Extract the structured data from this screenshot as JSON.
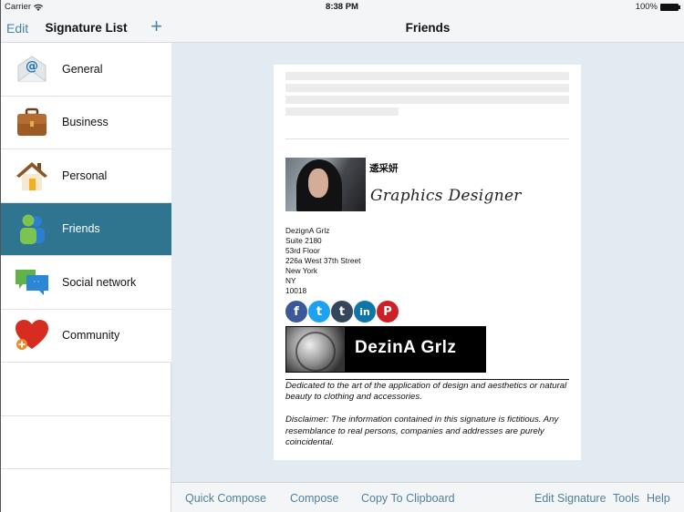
{
  "status_bar": {
    "carrier": "Carrier",
    "time": "8:38 PM",
    "battery": "100%"
  },
  "sidebar": {
    "edit_label": "Edit",
    "title": "Signature List",
    "add_label": "+",
    "items": [
      {
        "label": "General",
        "icon": "email-at-icon",
        "selected": false
      },
      {
        "label": "Business",
        "icon": "briefcase-icon",
        "selected": false
      },
      {
        "label": "Personal",
        "icon": "house-icon",
        "selected": false
      },
      {
        "label": "Friends",
        "icon": "people-icon",
        "selected": true
      },
      {
        "label": "Social network",
        "icon": "chat-bubbles-icon",
        "selected": false
      },
      {
        "label": "Community",
        "icon": "heart-plus-icon",
        "selected": false
      }
    ]
  },
  "main": {
    "title": "Friends",
    "signature": {
      "name": "逶采妍",
      "role": "Graphics Designer",
      "address": [
        "DezignA Grlz",
        "Suite 2180",
        "53rd Floor",
        "226a West 37th Street",
        "New York",
        "NY",
        "10018"
      ],
      "social": [
        {
          "name": "facebook",
          "glyph": "f",
          "color": "#3b5998"
        },
        {
          "name": "twitter",
          "glyph": "t",
          "color": "#1da1f2"
        },
        {
          "name": "tumblr",
          "glyph": "t",
          "color": "#35465c"
        },
        {
          "name": "linkedin",
          "glyph": "in",
          "color": "#0e76a8"
        },
        {
          "name": "pinterest",
          "glyph": "P",
          "color": "#cb2027"
        }
      ],
      "banner_text": "DezinA Grlz",
      "description": "Dedicated to the art of the application of design and aesthetics or natural beauty to clothing and accessories.",
      "disclaimer": "Disclaimer: The information contained in this signature is fictitious. Any resemblance to real persons, companies and addresses are purely coincidental."
    }
  },
  "toolbar": {
    "quick_compose": "Quick Compose",
    "compose": "Compose",
    "copy_clipboard": "Copy To Clipboard",
    "edit_signature": "Edit Signature",
    "tools": "Tools",
    "help": "Help"
  },
  "colors": {
    "accent": "#4a84a6",
    "selected_row": "#2f7590",
    "main_bg": "#e2ebf2"
  }
}
